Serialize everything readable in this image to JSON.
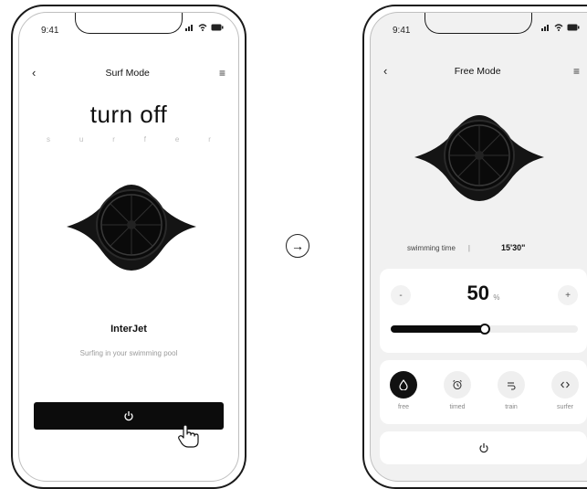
{
  "left_phone": {
    "status_time": "9:41",
    "nav": {
      "back": "‹",
      "title": "Surf Mode",
      "menu": "≡"
    },
    "headline": "turn off",
    "subletters": [
      "s",
      "u",
      "r",
      "f",
      "e",
      "r"
    ],
    "product_name": "InterJet",
    "tagline": "Surfing in your swimming pool"
  },
  "arrow": "→",
  "right_phone": {
    "status_time": "9:41",
    "nav": {
      "back": "‹",
      "title": "Free Mode",
      "menu": "≡"
    },
    "swim_label": "swimming time",
    "divider": "|",
    "swim_value": "15'30\"",
    "speed": {
      "minus": "-",
      "plus": "+",
      "value": "50",
      "unit": "%",
      "level": 0.5
    },
    "modes": [
      {
        "label": "free",
        "icon": "drop-icon",
        "active": true
      },
      {
        "label": "timed",
        "icon": "alarm-icon",
        "active": false
      },
      {
        "label": "train",
        "icon": "wave-icon",
        "active": false
      },
      {
        "label": "surfer",
        "icon": "code-icon",
        "active": false
      }
    ]
  },
  "colors": {
    "dark": "#0c0c0c",
    "panel": "#f1f1f1",
    "muted": "#888888"
  }
}
